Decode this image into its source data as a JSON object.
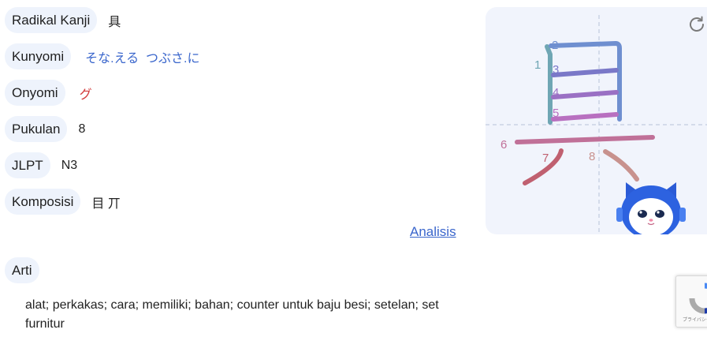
{
  "details": [
    {
      "label": "Radikal Kanji",
      "value": "具"
    },
    {
      "label": "Kunyomi",
      "value": "そな.える  つぶさ.に"
    },
    {
      "label": "Onyomi",
      "value": "グ"
    },
    {
      "label": "Pukulan",
      "value": "8"
    },
    {
      "label": "JLPT",
      "value": "N3"
    },
    {
      "label": "Komposisi",
      "value": "目 丌"
    }
  ],
  "analysis_link": "Analisis",
  "meaning": {
    "label": "Arti",
    "text": "alat; perkakas; cara; memiliki; bahan; counter untuk baju besi; setelan; set furnitur"
  },
  "stroke_numbers": [
    "1",
    "2",
    "3",
    "4",
    "5",
    "6",
    "7",
    "8"
  ],
  "icons": {
    "refresh": "refresh-icon",
    "mascot": "robot-cat-mascot",
    "captcha": "recaptcha-badge-icon"
  },
  "captcha_text": "プライバシー"
}
